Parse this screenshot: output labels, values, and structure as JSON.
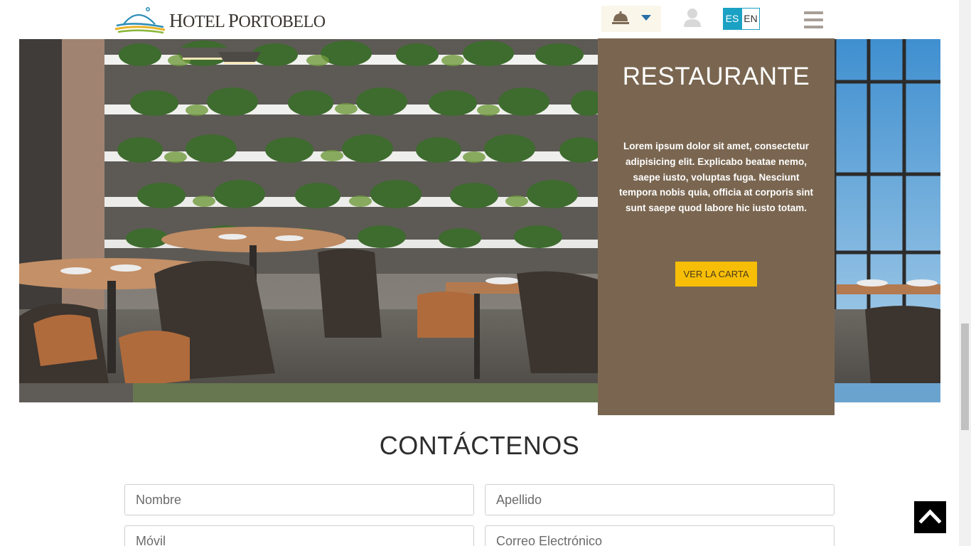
{
  "header": {
    "logo_text_1": "H",
    "logo_text_2": "OTEL ",
    "logo_text_3": "P",
    "logo_text_4": "ORTOBELO",
    "bell_icon": "reception-bell-icon",
    "dropdown_icon": "caret-down-icon",
    "user_icon": "user-icon",
    "languages": [
      "ES",
      "EN"
    ],
    "active_language": "ES",
    "menu_icon": "hamburger-menu-icon"
  },
  "restaurant": {
    "title": "RESTAURANTE",
    "description": "Lorem ipsum dolor sit amet, consectetur adipisicing elit. Explicabo beatae nemo, saepe iusto, voluptas fuga. Nesciunt tempora nobis quia, officia at corporis sint sunt saepe quod labore hic iusto totam.",
    "button_label": "VER LA CARTA"
  },
  "contact": {
    "title": "CONTÁCTENOS",
    "fields": {
      "nombre": "Nombre",
      "apellido": "Apellido",
      "movil": "Móvil",
      "correo": "Correo Electrónico"
    }
  },
  "colors": {
    "panel": "#7a6650",
    "button": "#f7be07",
    "lang_active": "#1aa1c4"
  },
  "back_to_top_icon": "chevron-up-icon"
}
